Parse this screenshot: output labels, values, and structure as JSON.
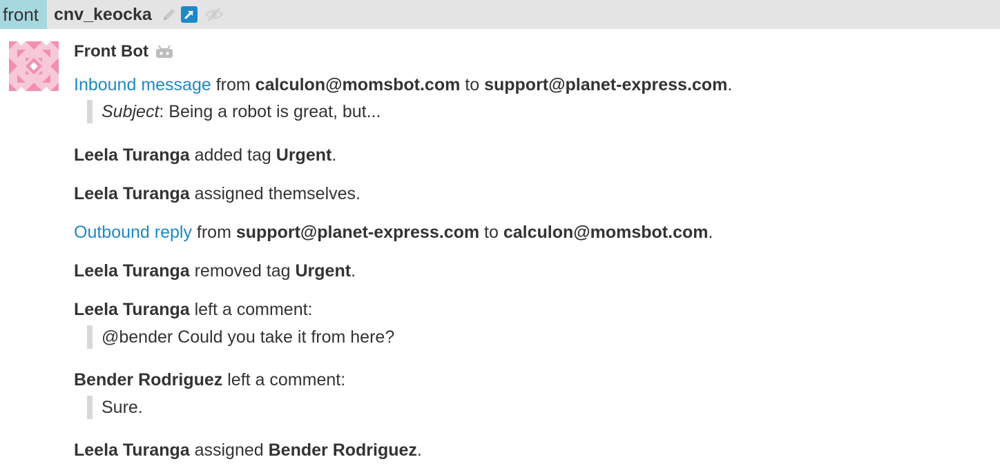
{
  "header": {
    "stream": "front",
    "topic": "cnv_keocka",
    "icons": [
      "pencil-icon",
      "external-link-icon",
      "mute-icon"
    ]
  },
  "message": {
    "sender": "Front Bot",
    "sender_badge": "bot-icon",
    "inbound": {
      "link": "Inbound message",
      "from_word": " from ",
      "from": "calculon@momsbot.com",
      "to_word": " to ",
      "to": "support@planet-express.com",
      "end": "."
    },
    "subject": {
      "label": "Subject",
      "sep": ": ",
      "text": "Being a robot is great, but..."
    },
    "events": {
      "tag_added": {
        "actor": "Leela Turanga",
        "verb": " added tag ",
        "tag": "Urgent",
        "end": "."
      },
      "assign_self": {
        "actor": "Leela Turanga",
        "verb": " assigned themselves."
      },
      "outbound": {
        "link": "Outbound reply",
        "from_word": " from ",
        "from": "support@planet-express.com",
        "to_word": " to ",
        "to": "calculon@momsbot.com",
        "end": "."
      },
      "tag_removed": {
        "actor": "Leela Turanga",
        "verb": " removed tag ",
        "tag": "Urgent",
        "end": "."
      },
      "comment1": {
        "actor": "Leela Turanga",
        "verb": " left a comment:",
        "text": "@bender Could you take it from here?"
      },
      "comment2": {
        "actor": "Bender Rodriguez",
        "verb": " left a comment:",
        "text": "Sure."
      },
      "assign_other": {
        "actor": "Leela Turanga",
        "verb": " assigned ",
        "target": "Bender Rodriguez",
        "end": "."
      }
    }
  },
  "colors": {
    "link": "#1e88c7",
    "stream_bg": "#a6d8e0",
    "header_bg": "#e4e4e4",
    "avatar_pink": "#f28fb0",
    "external_link_blue": "#1e88c7",
    "quote_bar": "#d8d8d8"
  }
}
